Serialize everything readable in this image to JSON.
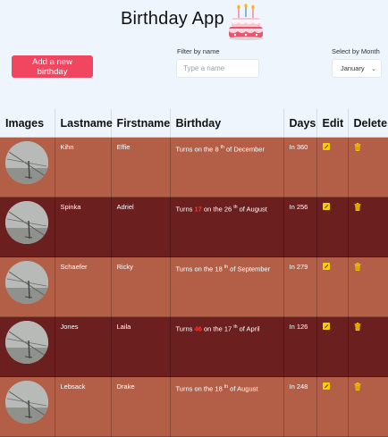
{
  "app": {
    "title": "Birthday App"
  },
  "toolbar": {
    "add_label": "Add a new birthday",
    "filter_label": "Filter by name",
    "filter_placeholder": "Type a name",
    "filter_value": "",
    "month_label": "Select by Month",
    "month_value": "January"
  },
  "table": {
    "headers": [
      "Images",
      "Lastname",
      "Firstname",
      "Birthday",
      "Days",
      "Edit",
      "Delete"
    ],
    "rows": [
      {
        "lastname": "Kihn",
        "firstname": "Effie",
        "prefix": "Turns",
        "age": "",
        "on": "on the",
        "day": "8",
        "suffix": "th",
        "of": "of",
        "month": "December",
        "days": "In 360"
      },
      {
        "lastname": "Spinka",
        "firstname": "Adriel",
        "prefix": "Turns",
        "age": "17",
        "on": "on the",
        "day": "26",
        "suffix": "th",
        "of": "of",
        "month": "August",
        "days": "In 256"
      },
      {
        "lastname": "Schaefer",
        "firstname": "Ricky",
        "prefix": "Turns",
        "age": "",
        "on": "on the",
        "day": "18",
        "suffix": "th",
        "of": "of",
        "month": "September",
        "days": "In 279"
      },
      {
        "lastname": "Jones",
        "firstname": "Laila",
        "prefix": "Turns",
        "age": "46",
        "on": "on the",
        "day": "17",
        "suffix": "th",
        "of": "of",
        "month": "April",
        "days": "In 126"
      },
      {
        "lastname": "Lebsack",
        "firstname": "Drake",
        "prefix": "Turns",
        "age": "",
        "on": "on the",
        "day": "18",
        "suffix": "th",
        "of": "of",
        "month": "August",
        "days": "In 248"
      }
    ]
  },
  "colors": {
    "accent": "#f0465f",
    "row_light": "#b35f47",
    "row_dark": "#6c1f1f",
    "age_red": "#ff3b30",
    "edit_yellow": "#f5d000",
    "delete_yellow": "#f2c200"
  },
  "icons": {
    "edit": "edit-icon",
    "delete": "trash-icon",
    "avatar": "avatar-photo",
    "logo": "birthday-cake-icon"
  }
}
